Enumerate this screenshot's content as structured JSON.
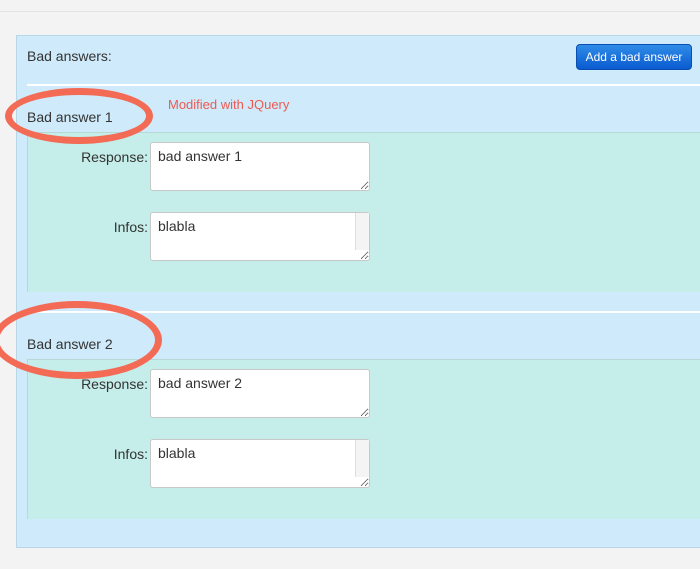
{
  "panel": {
    "title": "Bad answers:",
    "add_button_label": "Add a bad answer"
  },
  "annotation": {
    "modified_note": "Modified with JQuery"
  },
  "answers": [
    {
      "title": "Bad answer 1",
      "response_label": "Response:",
      "response_value": "bad answer 1",
      "infos_label": "Infos:",
      "infos_value": "blabla"
    },
    {
      "title": "Bad answer 2",
      "response_label": "Response:",
      "response_value": "bad answer 2",
      "infos_label": "Infos:",
      "infos_value": "blabla"
    }
  ],
  "colors": {
    "panel_bg": "#cfeafa",
    "well_bg": "#c5ede9",
    "button_blue": "#0a5bd0",
    "highlight_red": "#f36a55"
  }
}
